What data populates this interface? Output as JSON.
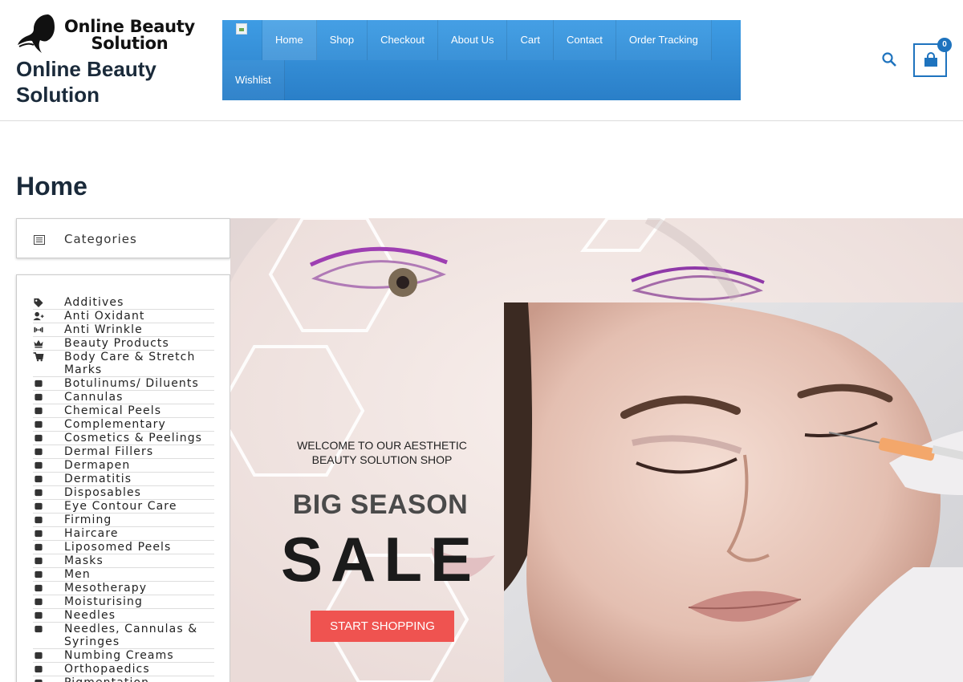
{
  "logo": {
    "line1": "Online Beauty",
    "line2": "Solution"
  },
  "site_title": "Online Beauty Solution",
  "nav": {
    "row1": [
      "Home",
      "Shop",
      "Checkout",
      "About Us",
      "Cart",
      "Contact",
      "Order Tracking"
    ],
    "row2": [
      "Wishlist"
    ],
    "active": "Home"
  },
  "cart": {
    "count": "0"
  },
  "page_title": "Home",
  "sidebar": {
    "header": "Categories",
    "categories": [
      {
        "label": "Additives",
        "icon": "tag-icon"
      },
      {
        "label": "Anti Oxidant",
        "icon": "user-plus-icon"
      },
      {
        "label": "Anti Wrinkle",
        "icon": "dumbbell-icon"
      },
      {
        "label": "Beauty Products",
        "icon": "crown-icon"
      },
      {
        "label": "Body Care & Stretch Marks",
        "icon": "cart-icon"
      },
      {
        "label": "Botulinums/ Diluents",
        "icon": "pills-icon"
      },
      {
        "label": "Cannulas",
        "icon": "skiing-icon"
      },
      {
        "label": "Chemical Peels",
        "icon": "bag-icon"
      },
      {
        "label": "Complementary",
        "icon": "warning-icon"
      },
      {
        "label": "Cosmetics & Peelings",
        "icon": "bar-chart-icon"
      },
      {
        "label": "Dermal Fillers",
        "icon": "line-chart-icon"
      },
      {
        "label": "Dermapen",
        "icon": "cake-icon"
      },
      {
        "label": "Dermatitis",
        "icon": "chess-icon"
      },
      {
        "label": "Disposables",
        "icon": "chess-bishop-icon"
      },
      {
        "label": "Eye Contour Care",
        "icon": "chessboard-icon"
      },
      {
        "label": "Firming",
        "icon": "chess-king-icon"
      },
      {
        "label": "Haircare",
        "icon": "chess-knight-icon"
      },
      {
        "label": "Liposomed Peels",
        "icon": "chess-pawn-icon"
      },
      {
        "label": "Masks",
        "icon": "chess-queen-icon"
      },
      {
        "label": "Men",
        "icon": "chess-rook-icon"
      },
      {
        "label": "Mesotherapy",
        "icon": "child-icon"
      },
      {
        "label": "Moisturising",
        "icon": "city-icon"
      },
      {
        "label": "Needles",
        "icon": "house-icon"
      },
      {
        "label": "Needles, Cannulas & Syringes",
        "icon": "clipboard-icon"
      },
      {
        "label": "Numbing Creams",
        "icon": "clipboard-list-icon"
      },
      {
        "label": "Orthopaedics",
        "icon": "cloud-icon"
      },
      {
        "label": "Pigmentation",
        "icon": "cocktail-icon"
      }
    ]
  },
  "hero": {
    "welcome": "WELCOME TO OUR AESTHETIC BEAUTY SOLUTION SHOP",
    "headline": "BIG SEASON",
    "sale": "SALE",
    "button": "START SHOPPING",
    "button_color": "#ef5350"
  },
  "colors": {
    "nav_blue": "#2f8ad4",
    "accent": "#1e73be"
  }
}
